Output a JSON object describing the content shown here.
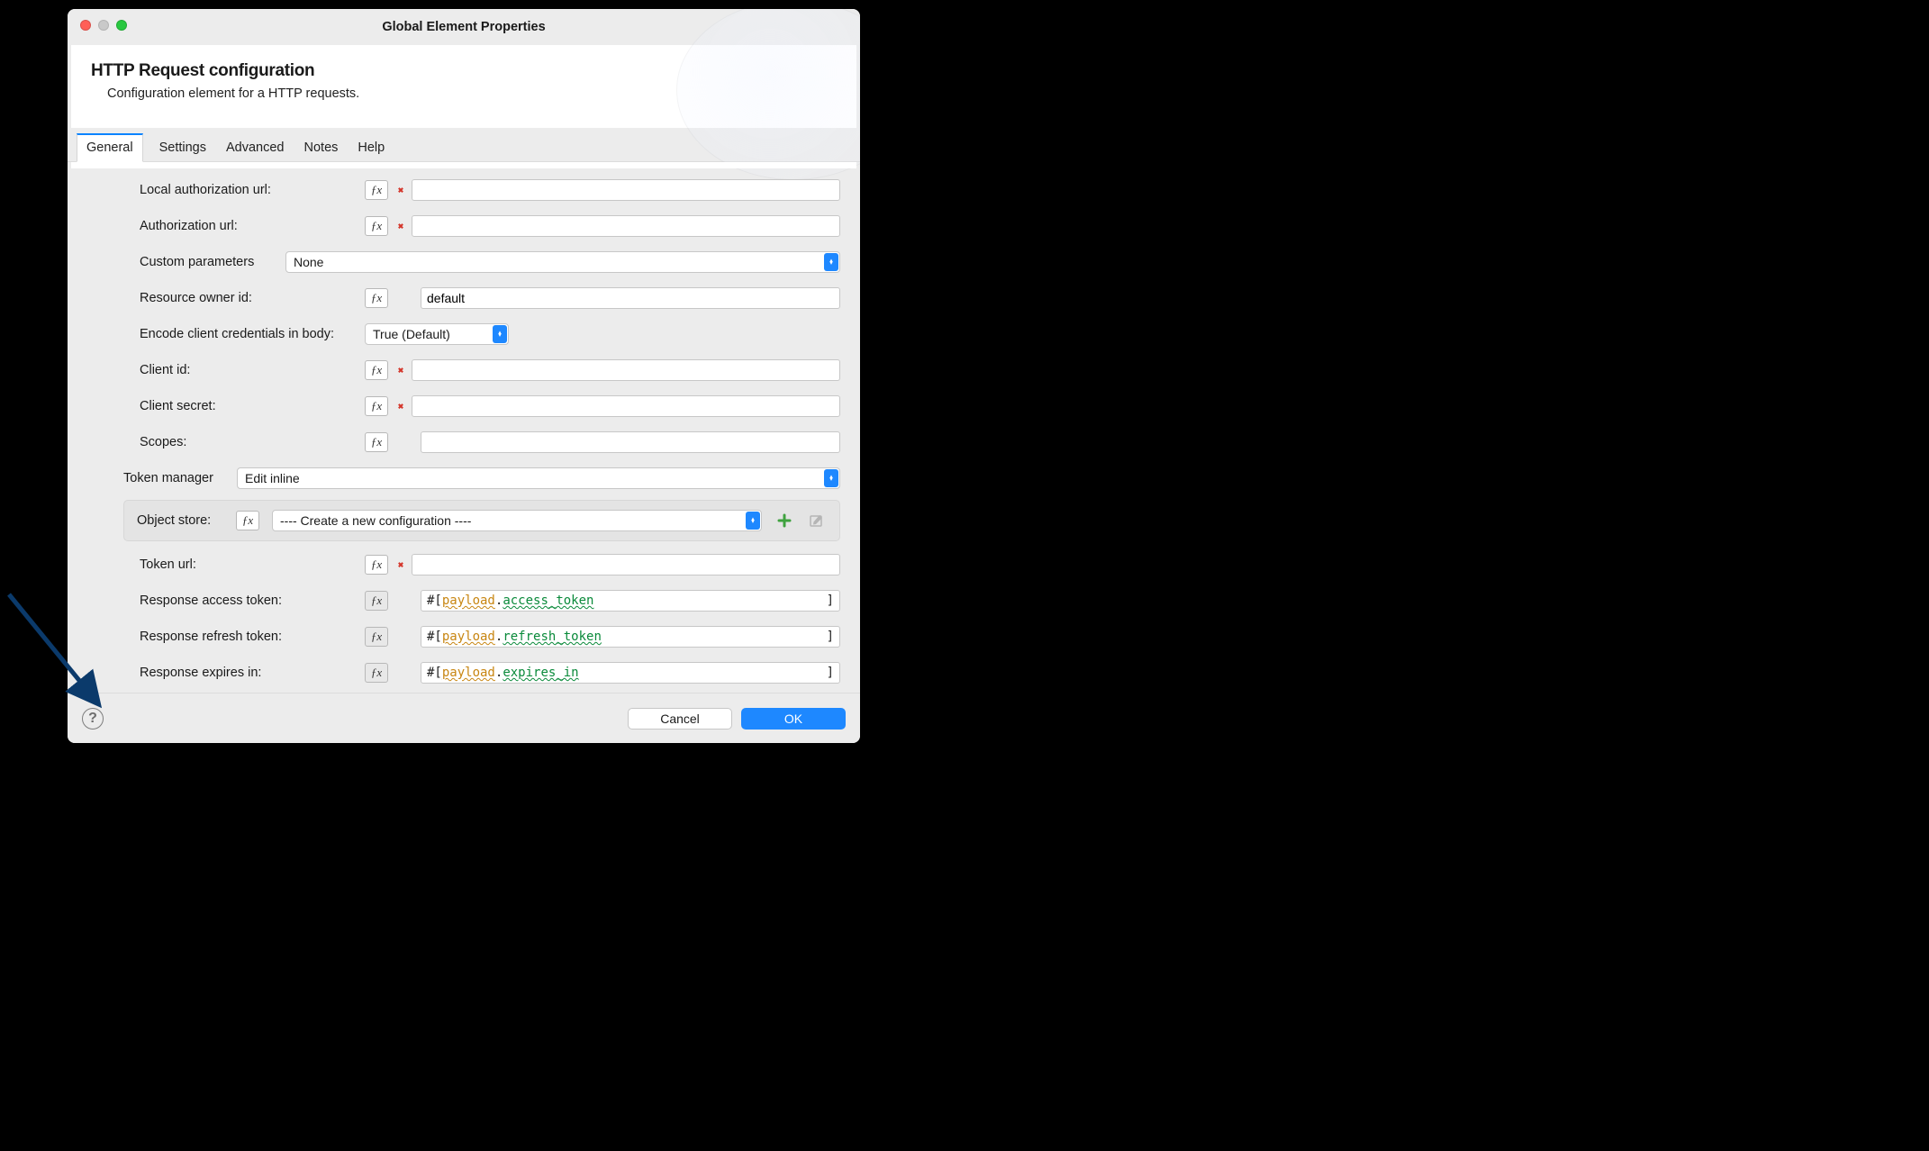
{
  "window": {
    "title": "Global Element Properties"
  },
  "header": {
    "title": "HTTP Request configuration",
    "subtitle": "Configuration element for a HTTP requests."
  },
  "tabs": [
    "General",
    "Settings",
    "Advanced",
    "Notes",
    "Help"
  ],
  "activeTab": "General",
  "fields": {
    "localAuthorizationUrl": {
      "label": "Local authorization url:",
      "value": "",
      "error": true
    },
    "authorizationUrl": {
      "label": "Authorization url:",
      "value": "",
      "error": true
    },
    "customParameters": {
      "label": "Custom parameters",
      "value": "None"
    },
    "resourceOwnerId": {
      "label": "Resource owner id:",
      "value": "default"
    },
    "encodeClientCredentials": {
      "label": "Encode client credentials in body:",
      "value": "True (Default)"
    },
    "clientId": {
      "label": "Client id:",
      "value": "",
      "error": true
    },
    "clientSecret": {
      "label": "Client secret:",
      "value": "",
      "error": true
    },
    "scopes": {
      "label": "Scopes:",
      "value": ""
    },
    "tokenManager": {
      "label": "Token manager",
      "value": "Edit inline"
    },
    "objectStore": {
      "label": "Object store:",
      "value": "---- Create a new configuration ----"
    },
    "tokenUrl": {
      "label": "Token url:",
      "value": "",
      "error": true
    },
    "responseAccessToken": {
      "label": "Response access token:",
      "prefix": "#[ ",
      "payload": "payload",
      "field": "access_token"
    },
    "responseRefreshToken": {
      "label": "Response refresh token:",
      "prefix": "#[ ",
      "payload": "payload",
      "field": "refresh_token"
    },
    "responseExpiresIn": {
      "label": "Response expires in:",
      "prefix": "#[ ",
      "payload": "payload",
      "field": "expires_in"
    }
  },
  "buttons": {
    "cancel": "Cancel",
    "ok": "OK"
  }
}
